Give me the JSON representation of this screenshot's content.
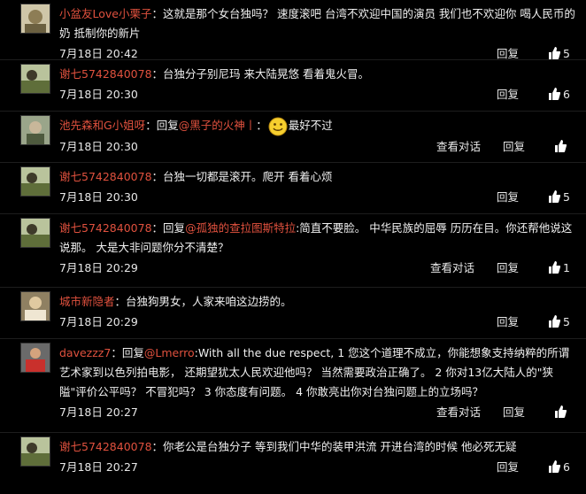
{
  "ui": {
    "reply": "回复",
    "view_conversation": "查看对话"
  },
  "comments": [
    {
      "user": "小盆友Love小栗子",
      "sep": "：",
      "text": "这就是那个女台独吗？ 速度滚吧  台湾不欢迎中国的演员  我们也不欢迎你   喝人民币的奶  抵制你的新片",
      "time": "7月18日 20:42",
      "likes": "5"
    },
    {
      "user": "谢七5742840078",
      "sep": "：",
      "text": "台独分子别尼玛 来大陆晃悠 看着鬼火冒。",
      "time": "7月18日 20:30",
      "likes": "6"
    },
    {
      "user": "池先森和G小姐呀",
      "sep": "：",
      "prefix": "回复",
      "target": "@黑子的火神丨",
      "sep2": "：",
      "emoji": "smile-emoji",
      "text": "最好不过",
      "time": "7月18日 20:30",
      "likes": ""
    },
    {
      "user": "谢七5742840078",
      "sep": "：",
      "text": "台独一切都是滚开。爬开 看着心烦",
      "time": "7月18日 20:30",
      "likes": "5"
    },
    {
      "user": "谢七5742840078",
      "sep": "：",
      "prefix": "回复",
      "target": "@孤独的查拉图斯特拉",
      "sep2": ":",
      "text": "简直不要脸。 中华民族的屈辱 历历在目。你还帮他说这说那。 大是大非问题你分不清楚？",
      "time": "7月18日 20:29",
      "likes": "1"
    },
    {
      "user": "城市新隐者",
      "sep": "：",
      "text": "台独狗男女，人家来咱这边捞的。",
      "time": "7月18日 20:29",
      "likes": "5"
    },
    {
      "user": "davezzz7",
      "sep": "：",
      "prefix": "回复",
      "target": "@Lmerro",
      "sep2": ":",
      "text": "With all the due respect, 1 您这个道理不成立，你能想象支持纳粹的所谓艺术家到以色列拍电影， 还期望犹太人民欢迎他吗？ 当然需要政治正确了。 2 你对13亿大陆人的\"狭隘\"评价公平吗？ 不冒犯吗？ 3 你态度有问题。 4 你敢亮出你对台独问题上的立场吗？",
      "time": "7月18日 20:27",
      "likes": ""
    },
    {
      "user": "谢七5742840078",
      "sep": "：",
      "text": "你老公是台独分子 等到我们中华的装甲洪流 开进台湾的时候 他必死无疑",
      "time": "7月18日 20:27",
      "likes": "6"
    }
  ]
}
